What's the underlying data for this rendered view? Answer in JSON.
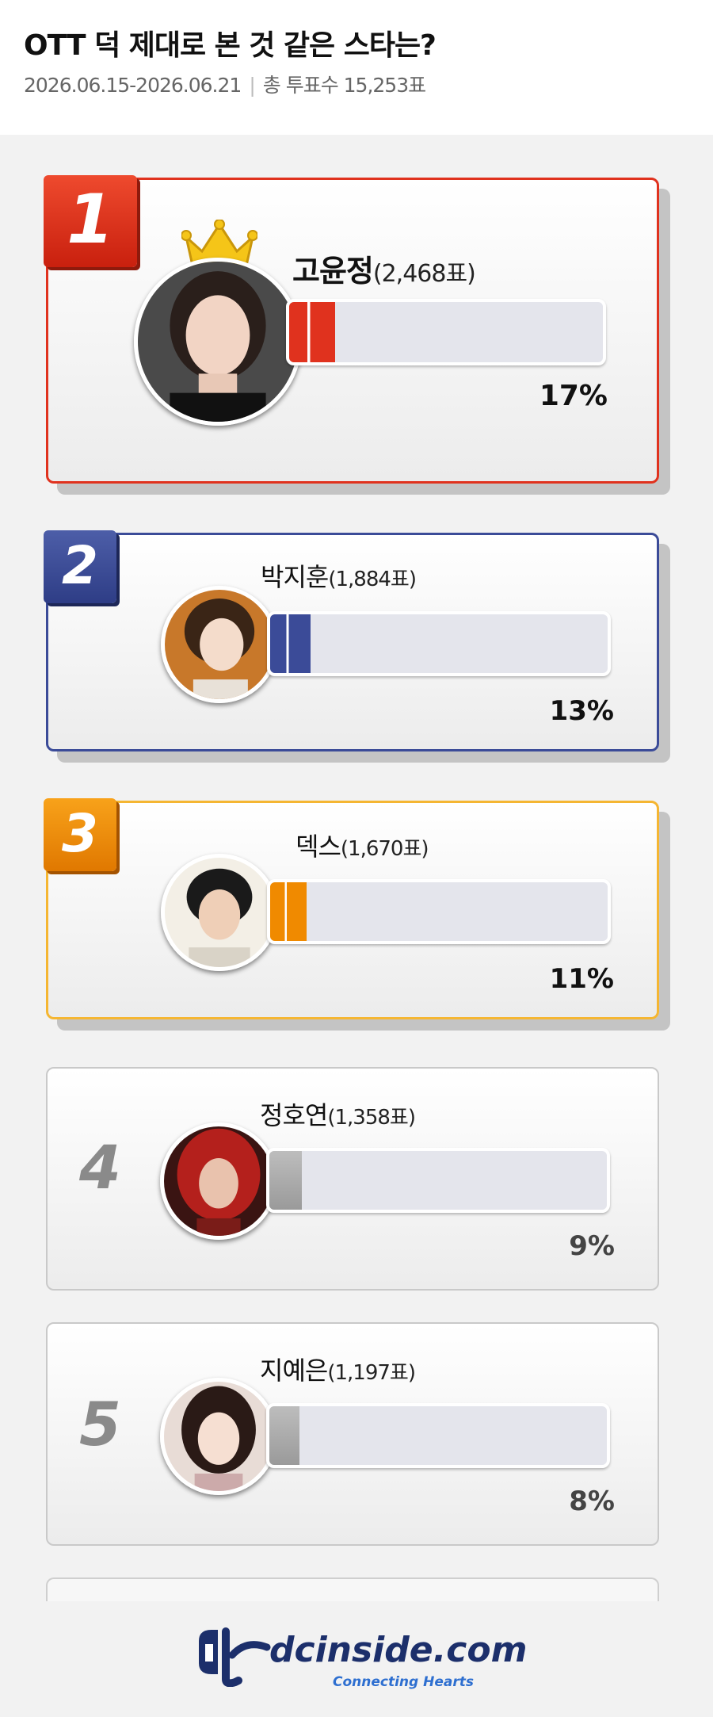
{
  "poll": {
    "title": "OTT 덕 제대로 본 것 같은 스타는?",
    "period": "2026.06.15-2026.06.21",
    "total_label": "총 투표수 15,253표"
  },
  "entries": [
    {
      "rank": "1",
      "name": "고윤정",
      "votes": "(2,468표)",
      "percent": "17%",
      "color": "#e0321e"
    },
    {
      "rank": "2",
      "name": "박지훈",
      "votes": "(1,884표)",
      "percent": "13%",
      "color": "#3b4b98"
    },
    {
      "rank": "3",
      "name": "덱스",
      "votes": "(1,670표)",
      "percent": "11%",
      "color": "#f08a00"
    },
    {
      "rank": "4",
      "name": "정호연",
      "votes": "(1,358표)",
      "percent": "9%",
      "color": "#9a9a9a"
    },
    {
      "rank": "5",
      "name": "지예은",
      "votes": "(1,197표)",
      "percent": "8%",
      "color": "#9a9a9a"
    }
  ],
  "shares": [
    0.17,
    0.13,
    0.11,
    0.09,
    0.08
  ],
  "icons": {
    "crown": "crown-icon",
    "logo": "dcinside-logo"
  },
  "footer": {
    "brand": "dcinside.com",
    "tagline": "Connecting Hearts"
  }
}
